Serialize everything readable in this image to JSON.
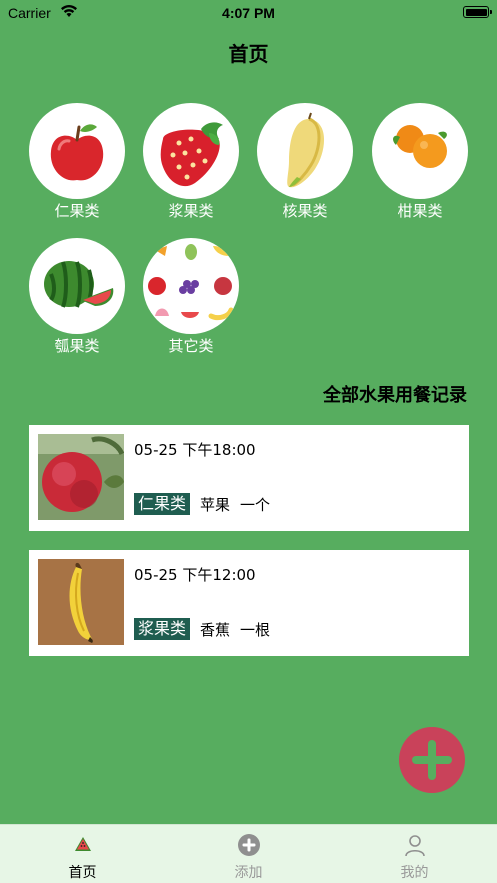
{
  "status_bar": {
    "carrier": "Carrier",
    "time": "4:07 PM"
  },
  "nav": {
    "title": "首页"
  },
  "categories": [
    {
      "label": "仁果类",
      "icon": "apple-icon"
    },
    {
      "label": "浆果类",
      "icon": "strawberry-icon"
    },
    {
      "label": "核果类",
      "icon": "mango-icon"
    },
    {
      "label": "柑果类",
      "icon": "orange-icon"
    },
    {
      "label": "瓠果类",
      "icon": "watermelon-icon"
    },
    {
      "label": "其它类",
      "icon": "mixed-fruits-icon"
    }
  ],
  "records_section": {
    "title": "全部水果用餐记录"
  },
  "records": [
    {
      "time": "05-25 下午18:00",
      "category": "仁果类",
      "fruit": "苹果",
      "amount": "一个",
      "photo": "apple-photo"
    },
    {
      "time": "05-25 下午12:00",
      "category": "浆果类",
      "fruit": "香蕉",
      "amount": "一根",
      "photo": "banana-photo"
    }
  ],
  "fab": {
    "icon": "plus-icon",
    "color": "#c9425a"
  },
  "tabbar": {
    "tabs": [
      {
        "label": "首页",
        "icon": "watermelon-slice-icon",
        "active": true
      },
      {
        "label": "添加",
        "icon": "add-circle-icon",
        "active": false
      },
      {
        "label": "我的",
        "icon": "user-icon",
        "active": false
      }
    ]
  },
  "colors": {
    "background": "#57ad5f",
    "tag": "#1f5d50",
    "tabbar": "#e7f6e6",
    "fab": "#c9425a"
  }
}
